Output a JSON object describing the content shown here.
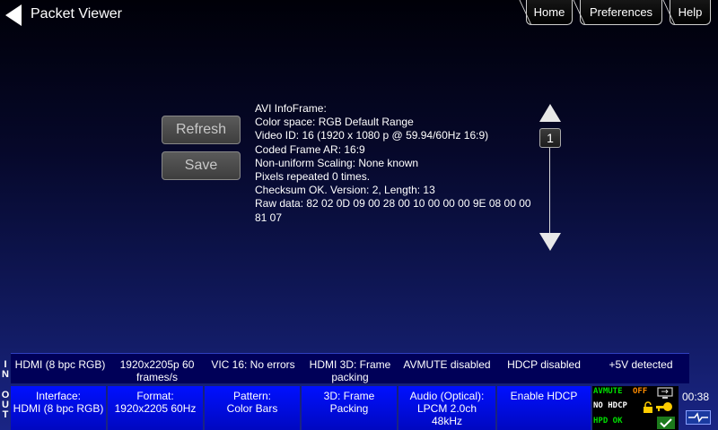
{
  "header": {
    "title": "Packet Viewer",
    "tabs": [
      {
        "label": "Home"
      },
      {
        "label": "Preferences"
      },
      {
        "label": "Help"
      }
    ]
  },
  "actions": {
    "refresh_label": "Refresh",
    "save_label": "Save"
  },
  "packet": {
    "lines": [
      "AVI InfoFrame:",
      "Color space: RGB Default Range",
      "Video ID: 16 (1920 x 1080 p @ 59.94/60Hz 16:9)",
      "Coded Frame AR: 16:9",
      "Non-uniform Scaling: None known",
      "Pixels repeated 0 times.",
      "Checksum OK. Version: 2, Length: 13",
      "Raw data: 82 02 0D 09 00 28 00 10 00 00 00 9E 08 00 00",
      "81 07"
    ]
  },
  "pager": {
    "current_page": "1"
  },
  "input_status": {
    "label_letters": [
      "I",
      "N"
    ],
    "cells": [
      {
        "line1": "HDMI (8 bpc RGB)",
        "line2": ""
      },
      {
        "line1": "1920x2205p 60",
        "line2": "frames/s"
      },
      {
        "line1": "VIC 16: No errors",
        "line2": ""
      },
      {
        "line1": "HDMI 3D: Frame",
        "line2": "packing"
      },
      {
        "line1": "AVMUTE disabled",
        "line2": ""
      },
      {
        "line1": "HDCP disabled",
        "line2": ""
      },
      {
        "line1": "+5V detected",
        "line2": ""
      }
    ]
  },
  "output_status": {
    "label_letters": [
      "O",
      "U",
      "T"
    ],
    "cells": [
      {
        "line1": "Interface:",
        "line2": "HDMI (8 bpc RGB)",
        "line3": ""
      },
      {
        "line1": "Format:",
        "line2": "1920x2205 60Hz",
        "line3": ""
      },
      {
        "line1": "Pattern:",
        "line2": "Color Bars",
        "line3": ""
      },
      {
        "line1": "3D: Frame",
        "line2": "Packing",
        "line3": ""
      },
      {
        "line1": "Audio (Optical):",
        "line2": "LPCM 2.0ch",
        "line3": "48kHz"
      },
      {
        "line1": "Enable HDCP",
        "line2": "",
        "line3": ""
      }
    ]
  },
  "indicators": {
    "avmute_label": "AVMUTE",
    "avmute_state": "OFF",
    "hdcp": "NO HDCP",
    "hpd": "HPD OK",
    "colors": {
      "green": "#00e000",
      "orange": "#ff8c00",
      "white": "#ffffff"
    }
  },
  "clock": "00:38",
  "icons": {
    "back": "back-arrow-icon",
    "up": "up-triangle-icon",
    "down": "down-triangle-icon",
    "lock": "lock-icon",
    "key": "key-icon",
    "monitor": "monitor-icon",
    "check": "check-icon",
    "cable": "cable-icon"
  }
}
